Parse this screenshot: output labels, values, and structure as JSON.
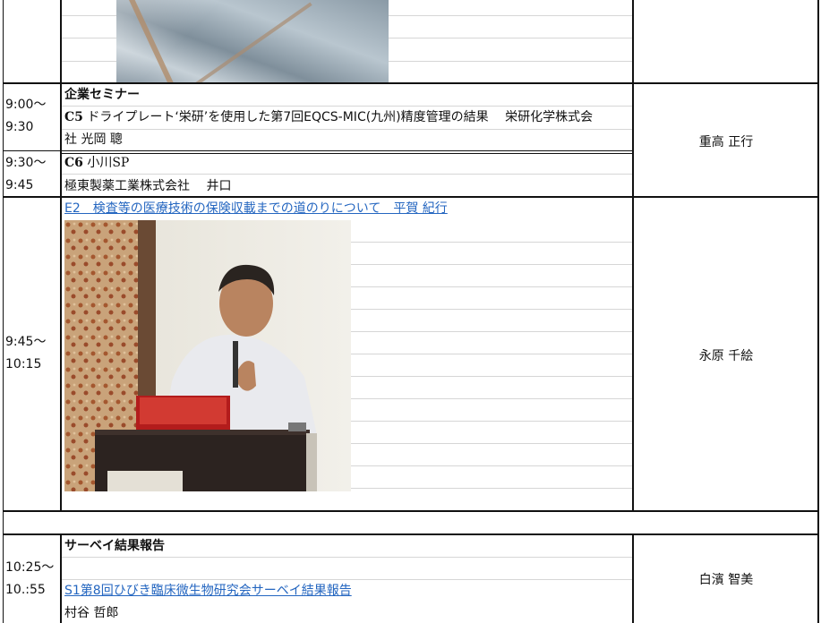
{
  "rows": {
    "seminar": {
      "time_start": "9:00～",
      "time_end": "9:30",
      "heading": "企業セミナー",
      "code": "C5",
      "text_line1": "ドライプレート‘栄研’を使用した第7回EQCS-MIC(九州)精度管理の結果　 栄研化学株式会",
      "text_line2": "社  光岡  聰",
      "chair": "重高  正行"
    },
    "c6": {
      "time_start": "9:30～",
      "time_end": "9:45",
      "code": "C6",
      "title": "小川SP",
      "presenter": "極東製薬工業株式会社　 井口"
    },
    "e2": {
      "time_start": "9:45～",
      "time_end": "10:15",
      "link_text": "E2　検査等の医療技術の保険収載までの道のりについて　平賀 紀行",
      "chair": "永原  千絵"
    },
    "survey": {
      "time_start": "10:25～",
      "time_end": "10.:55",
      "heading": "サーベイ結果報告",
      "link_text": "S1第8回ひびき臨床微生物研究会サーベイ結果報告",
      "presenter": "村谷 哲郎",
      "chair": "白濱 智美"
    }
  },
  "colors": {
    "link": "#2466c0",
    "grid": "#111111",
    "faint": "#d6d6d6"
  }
}
